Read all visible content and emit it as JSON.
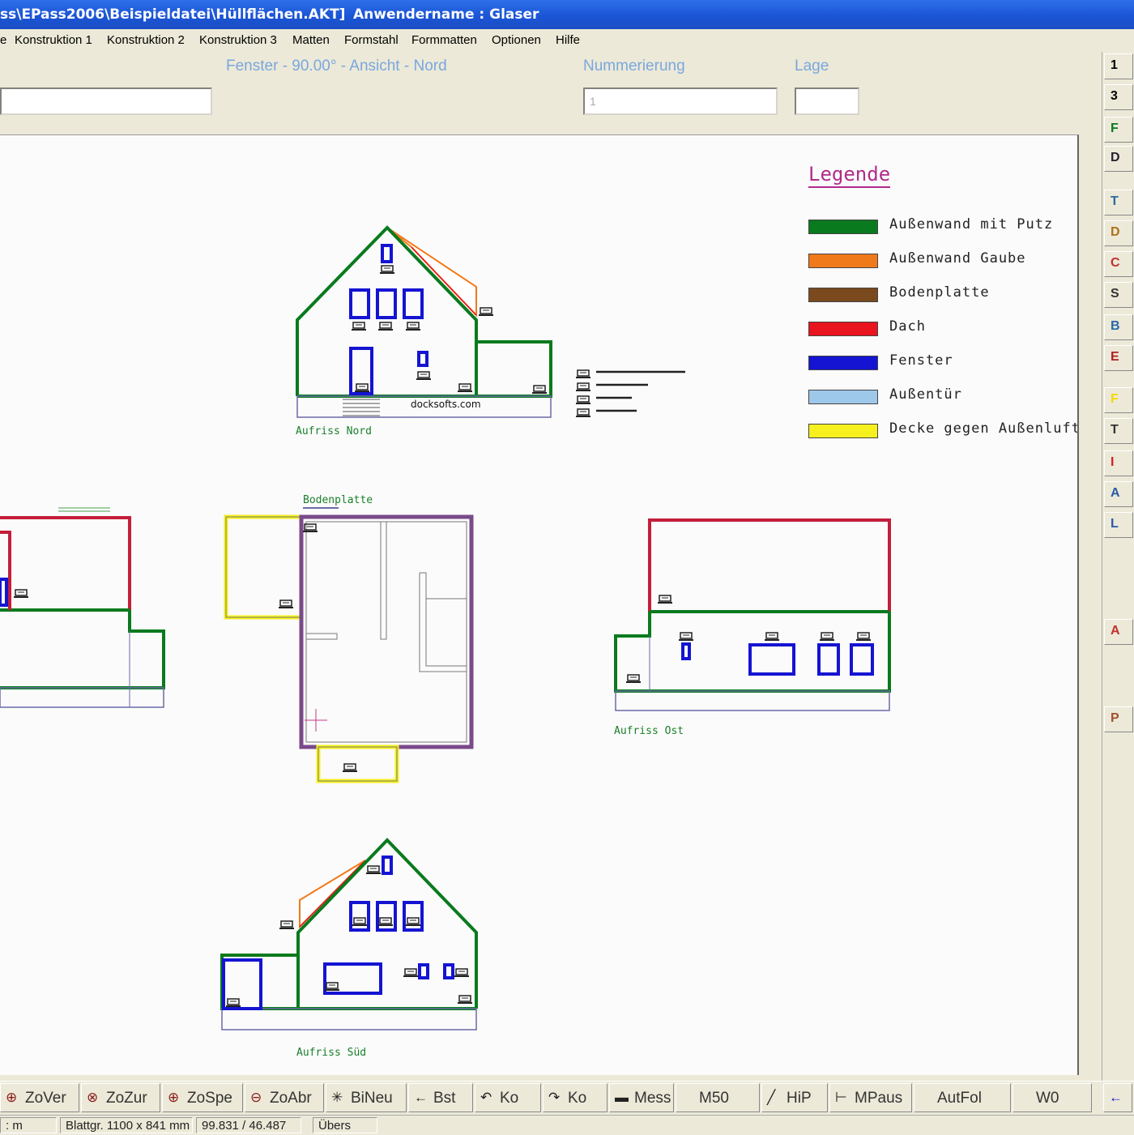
{
  "window": {
    "title": "ss\\EPass2006\\Beispieldatei\\Hüllflächen.AKT]",
    "user": "Anwendername : Glaser"
  },
  "menu": [
    "e",
    "Konstruktion 1",
    "Konstruktion 2",
    "Konstruktion 3",
    "Matten",
    "Formstahl",
    "Formmatten",
    "Optionen",
    "Hilfe"
  ],
  "fields": {
    "element_label": "Fenster - 90.00° - Ansicht - Nord",
    "numbering_label": "Nummerierung",
    "numbering_value": "1",
    "position_label": "Lage",
    "position_value": ""
  },
  "legend": {
    "title": "Legende",
    "items": [
      {
        "label": "Außenwand mit Putz",
        "color": "#0a7a1e"
      },
      {
        "label": "Außenwand Gaube",
        "color": "#f07a1a"
      },
      {
        "label": "Bodenplatte",
        "color": "#7a4a1e"
      },
      {
        "label": "Dach",
        "color": "#e8141e"
      },
      {
        "label": "Fenster",
        "color": "#1414d2"
      },
      {
        "label": "Außentür",
        "color": "#9ec8ea"
      },
      {
        "label": "Decke gegen Außenluft",
        "color": "#f5f01e"
      }
    ]
  },
  "drawing": {
    "label_north": "Aufriss Nord",
    "label_east": "Aufriss Ost",
    "label_south": "Aufriss Süd",
    "label_floor": "Bodenplatte",
    "watermark": "docksofts.com"
  },
  "right_toolbar": [
    "1",
    "3",
    "F",
    "D",
    "T",
    "D",
    "C",
    "S",
    "B",
    "E",
    "F",
    "T",
    "I",
    "A",
    "L",
    "A",
    "P"
  ],
  "bottom_toolbar": [
    {
      "icon": "zoom-previous-icon",
      "label": "ZoVer"
    },
    {
      "icon": "zoom-back-icon",
      "label": "ZoZur"
    },
    {
      "icon": "zoom-save-icon",
      "label": "ZoSpe"
    },
    {
      "icon": "zoom-out-icon",
      "label": "ZoAbr"
    },
    {
      "icon": "redraw-icon",
      "label": "BiNeu"
    },
    {
      "icon": "arrow-left-icon",
      "label": "Bst"
    },
    {
      "icon": "undo-icon",
      "label": "Ko"
    },
    {
      "icon": "redo-icon",
      "label": "Ko"
    },
    {
      "icon": "ruler-icon",
      "label": "Mess"
    },
    {
      "icon": "",
      "label": "M50"
    },
    {
      "icon": "line-icon",
      "label": "HiP"
    },
    {
      "icon": "dimension-icon",
      "label": "MPaus"
    },
    {
      "icon": "",
      "label": "AutFol"
    },
    {
      "icon": "",
      "label": "W0"
    }
  ],
  "status": {
    "unit": ": m",
    "sheet": "Blattgr. 1100 x 841 mm",
    "coords": "99.831 / 46.487",
    "mode": "Übers"
  },
  "colors": {
    "titlebar": "#1b55d6",
    "label_blue": "#7aa7de",
    "wall_green": "#0a7a1e",
    "roof_red": "#e8141e",
    "window_blue": "#1414d2",
    "gable_orange": "#f07a1a",
    "ceiling_yellow": "#f5f01e"
  }
}
